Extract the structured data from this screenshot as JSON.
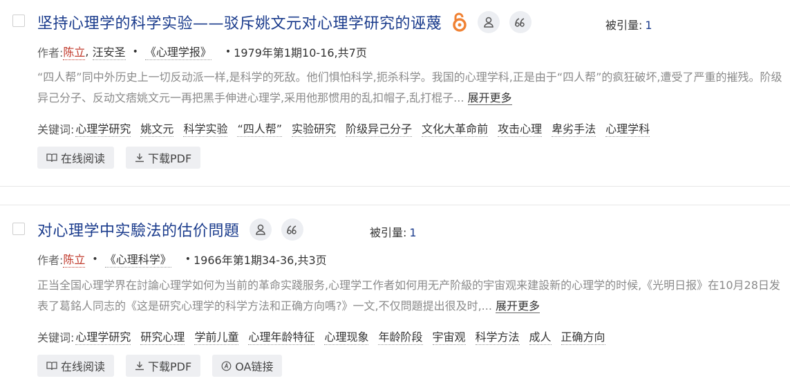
{
  "results": [
    {
      "title": "坚持心理学的科学实验——驳斥姚文元对心理学研究的诬蔑",
      "cite_label": "被引量:",
      "cite_count": "1",
      "author_label": "作者:",
      "authors": [
        "陈立",
        "汪安圣"
      ],
      "journal": "《心理学报》",
      "issue": "1979年第1期10-16,共7页",
      "abstract": "“四人帮”同中外历史上一切反动派一样,是科学的死敌。他们惧怕科学,扼杀科学。我国的心理学科,正是由于“四人帮”的疯狂破坏,遭受了严重的摧残。阶级异己分子、反动文痞姚文元一再把黑手伸进心理学,采用他那惯用的乱扣帽子,乱打棍子...",
      "more_label": "展开更多",
      "keywords_label": "关键词:",
      "keywords": [
        "心理学研究",
        "姚文元",
        "科学实验",
        "“四人帮”",
        "实验研究",
        "阶级异己分子",
        "文化大革命前",
        "攻击心理",
        "卑劣手法",
        "心理学科"
      ],
      "buttons": [
        "在线阅读",
        "下载PDF"
      ]
    },
    {
      "title": "对心理学中实驗法的估价問題",
      "cite_label": "被引量:",
      "cite_count": "1",
      "author_label": "作者:",
      "authors": [
        "陈立"
      ],
      "journal": "《心理科学》",
      "issue": "1966年第1期34-36,共3页",
      "abstract": "正当全国心理学界在討論心理学如何为当前的革命实踐服务,心理学工作者如何用无产阶級的宇宙观来建設新的心理学的时候,《光明日报》在10月28日发表了葛銘人同志的《这是研究心理学的科学方法和正确方向嗎?》一文,不仅問題提出很及时,...",
      "more_label": "展开更多",
      "keywords_label": "关键词:",
      "keywords": [
        "心理学研究",
        "研究心理",
        "学前儿童",
        "心理年龄特征",
        "心理现象",
        "年龄阶段",
        "宇宙观",
        "科学方法",
        "成人",
        "正确方向"
      ],
      "buttons": [
        "在线阅读",
        "下载PDF",
        "OA链接"
      ]
    }
  ],
  "colors": {
    "title": "#1a3b8c",
    "author_highlight": "#c0392b",
    "oa_orange": "#f08234"
  },
  "icons": [
    "open-access-icon",
    "author-icon",
    "quote-icon",
    "book-icon",
    "download-icon",
    "oa-link-icon"
  ]
}
